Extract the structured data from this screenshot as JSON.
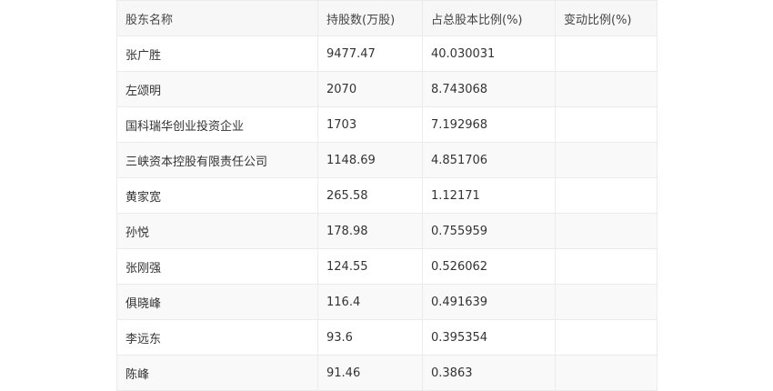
{
  "table": {
    "headers": [
      "股东名称",
      "持股数(万股)",
      "占总股本比例(%)",
      "变动比例(%)"
    ],
    "rows": [
      [
        "张广胜",
        "9477.47",
        "40.030031",
        ""
      ],
      [
        "左颂明",
        "2070",
        "8.743068",
        ""
      ],
      [
        "国科瑞华创业投资企业",
        "1703",
        "7.192968",
        ""
      ],
      [
        "三峡资本控股有限责任公司",
        "1148.69",
        "4.851706",
        ""
      ],
      [
        "黄家宽",
        "265.58",
        "1.12171",
        ""
      ],
      [
        "孙悦",
        "178.98",
        "0.755959",
        ""
      ],
      [
        "张刚强",
        "124.55",
        "0.526062",
        ""
      ],
      [
        "俱晓峰",
        "116.4",
        "0.491639",
        ""
      ],
      [
        "李远东",
        "93.6",
        "0.395354",
        ""
      ],
      [
        "陈峰",
        "91.46",
        "0.3863",
        ""
      ]
    ]
  }
}
